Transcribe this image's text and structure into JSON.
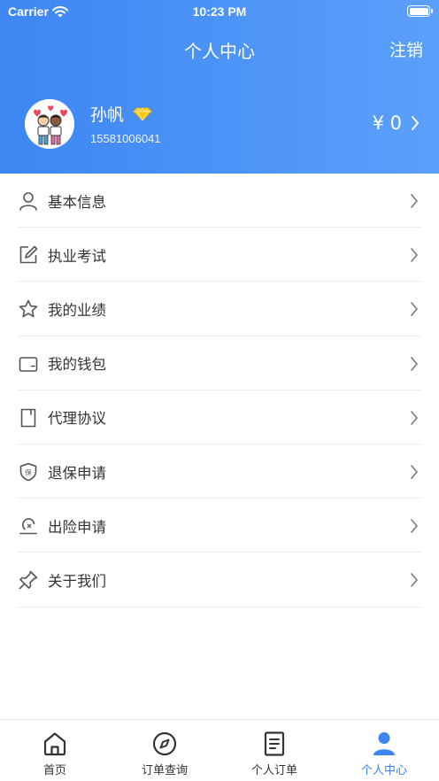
{
  "status_bar": {
    "carrier": "Carrier",
    "time": "10:23 PM"
  },
  "header": {
    "title": "个人中心",
    "logout_label": "注销",
    "user": {
      "name": "孙帆",
      "phone": "15581006041"
    },
    "balance_text": "¥ 0"
  },
  "menu": {
    "items": [
      {
        "label": "基本信息",
        "icon": "user-icon"
      },
      {
        "label": "执业考试",
        "icon": "edit-icon"
      },
      {
        "label": "我的业绩",
        "icon": "star-icon"
      },
      {
        "label": "我的钱包",
        "icon": "wallet-icon"
      },
      {
        "label": "代理协议",
        "icon": "document-icon"
      },
      {
        "label": "退保申请",
        "icon": "shield-icon"
      },
      {
        "label": "出险申请",
        "icon": "claim-icon"
      },
      {
        "label": "关于我们",
        "icon": "pin-icon"
      }
    ]
  },
  "tabbar": {
    "items": [
      {
        "label": "首页",
        "icon": "home-icon"
      },
      {
        "label": "订单查询",
        "icon": "compass-icon"
      },
      {
        "label": "个人订单",
        "icon": "order-icon"
      },
      {
        "label": "个人中心",
        "icon": "person-icon",
        "active": true
      }
    ]
  },
  "colors": {
    "primary": "#3d86f2",
    "header_gradient_end": "#5aa0fb",
    "text": "#333333",
    "divider": "#ececec",
    "vip_diamond": "#f5c518"
  }
}
